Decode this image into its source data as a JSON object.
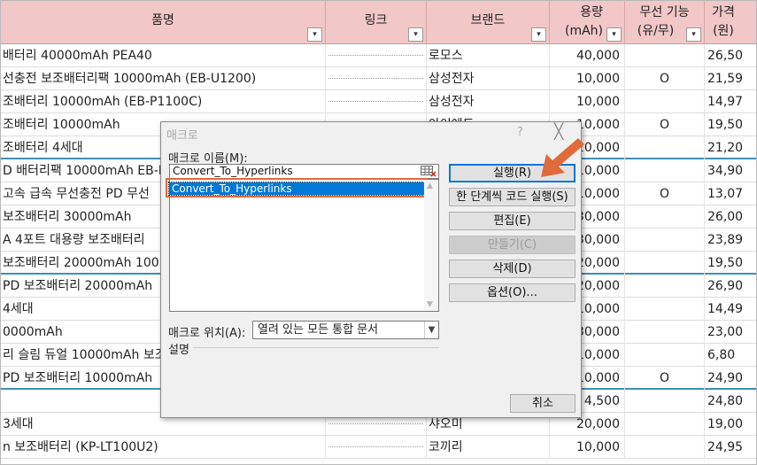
{
  "sheet": {
    "headers": {
      "name": "품명",
      "link": "링크",
      "brand": "브랜드",
      "capacity_l1": "용량",
      "capacity_l2": "(mAh)",
      "wireless_l1": "무선 기능",
      "wireless_l2": "(유/무)",
      "price_l1": "가격",
      "price_l2": "(원)"
    },
    "filter_glyph": "▾",
    "rows": [
      {
        "name": "배터리 40000mAh PEA40",
        "brand": "로모스",
        "capacity": "40,000",
        "wireless": "",
        "price": "26,50"
      },
      {
        "name": "선충전 보조배터리팩 10000mAh (EB-U1200)",
        "brand": "삼성전자",
        "capacity": "10,000",
        "wireless": "O",
        "price": "21,59"
      },
      {
        "name": "조배터리 10000mAh (EB-P1100C)",
        "brand": "삼성전자",
        "capacity": "10,000",
        "wireless": "",
        "price": "14,97"
      },
      {
        "name": "조배터리 10000mAh",
        "brand": "아이에드",
        "capacity": "10,000",
        "wireless": "O",
        "price": "19,50"
      },
      {
        "name": "조배터리 4세대",
        "brand": "",
        "capacity": "20,000",
        "wireless": "",
        "price": "21,20"
      },
      {
        "name": "D 배터리팩 10000mAh EB-P",
        "brand": "",
        "capacity": "10,000",
        "wireless": "",
        "price": "34,90"
      },
      {
        "name": "고속 급속 무선충전 PD 무선",
        "brand": "",
        "capacity": "10,000",
        "wireless": "O",
        "price": "13,07"
      },
      {
        "name": "보조배터리 30000mAh",
        "brand": "",
        "capacity": "30,000",
        "wireless": "",
        "price": "26,00"
      },
      {
        "name": "A 4포트 대용량 보조배터리",
        "brand": "",
        "capacity": "30,000",
        "wireless": "",
        "price": "23,89"
      },
      {
        "name": "보조배터리 20000mAh 100",
        "brand": "",
        "capacity": "20,000",
        "wireless": "",
        "price": "19,50"
      },
      {
        "name": " PD 보조배터리 20000mAh",
        "brand": "",
        "capacity": "20,000",
        "wireless": "",
        "price": "26,90"
      },
      {
        "name": "4세대",
        "brand": "",
        "capacity": "10,000",
        "wireless": "",
        "price": "14,49"
      },
      {
        "name": "0000mAh",
        "brand": "",
        "capacity": "30,000",
        "wireless": "",
        "price": "23,00"
      },
      {
        "name": "리 슬림 듀얼 10000mAh 보조",
        "brand": "",
        "capacity": "10,000",
        "wireless": "",
        "price": "6,80"
      },
      {
        "name": " PD 보조배터리 10000mAh",
        "brand": "",
        "capacity": "10,000",
        "wireless": "O",
        "price": "24,90"
      },
      {
        "name": "",
        "brand": "",
        "capacity": "4,500",
        "wireless": "",
        "price": "24,80"
      },
      {
        "name": "3세대",
        "brand": "샤오미",
        "capacity": "20,000",
        "wireless": "",
        "price": "19,00"
      },
      {
        "name": "n 보조배터리 (KP-LT100U2)",
        "brand": "코끼리",
        "capacity": "10,000",
        "wireless": "",
        "price": "24,95"
      }
    ]
  },
  "dialog": {
    "title": "매크로",
    "help": "?",
    "close": "╳",
    "name_label": "매크로 이름(M):",
    "name_value": "Convert_To_Hyperlinks",
    "list_items": [
      "Convert_To_Hyperlinks"
    ],
    "buttons": {
      "run": "실행(R)",
      "step": "한 단계씩 코드 실행(S)",
      "edit": "편집(E)",
      "create": "만들기(C)",
      "delete": "삭제(D)",
      "options": "옵션(O)...",
      "cancel": "취소"
    },
    "location_label": "매크로 위치(A):",
    "location_value": "열려 있는 모든 통합 문서",
    "description_label": "설명"
  },
  "colors": {
    "header_bg": "#f2c7c7",
    "selection": "#0078d7",
    "annotation": "#e06a3a",
    "group_separator": "#3d8fb5"
  },
  "icons": {
    "filter": "filter-dropdown-icon",
    "refedit": "ref-edit-icon",
    "annotation": "red-pointer-arrow-icon"
  }
}
